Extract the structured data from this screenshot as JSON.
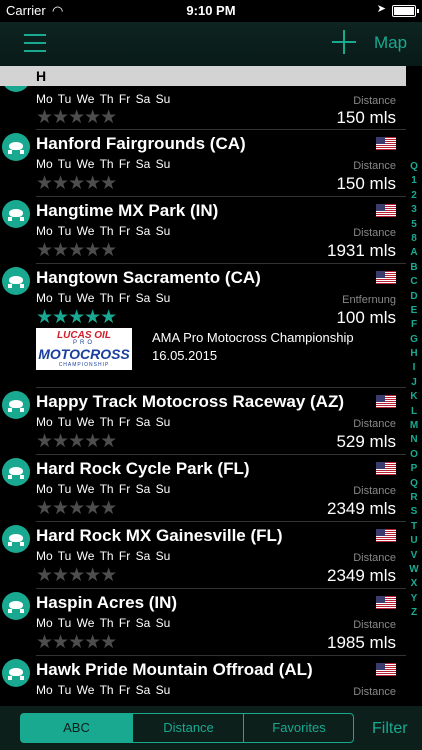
{
  "status": {
    "carrier": "Carrier",
    "time": "9:10 PM"
  },
  "nav": {
    "map_label": "Map"
  },
  "section": {
    "letter": "H"
  },
  "labels": {
    "days": "Mo Tu We Th Fr Sa Su",
    "stars": "★★★★★"
  },
  "rows": [
    {
      "title": "",
      "distance_label": "Distance",
      "distance": "150 mls",
      "rating": 0
    },
    {
      "title": "Hanford Fairgrounds (CA)",
      "distance_label": "Distance",
      "distance": "150 mls",
      "rating": 0
    },
    {
      "title": "Hangtime MX Park (IN)",
      "distance_label": "Distance",
      "distance": "1931 mls",
      "rating": 0
    },
    {
      "title": "Hangtown Sacramento (CA)",
      "distance_label": "Entfernung",
      "distance": "100 mls",
      "rating": 5,
      "event": {
        "title": "AMA Pro Motocross Championship",
        "date": "16.05.2015",
        "logo_lines": [
          "LUCAS OIL",
          "PRO",
          "MOTOCROSS",
          "CHAMPIONSHIP"
        ]
      }
    },
    {
      "title": "Happy Track Motocross Raceway (AZ)",
      "distance_label": "Distance",
      "distance": "529 mls",
      "rating": 0
    },
    {
      "title": "Hard Rock Cycle Park (FL)",
      "distance_label": "Distance",
      "distance": "2349 mls",
      "rating": 0
    },
    {
      "title": "Hard Rock MX Gainesville (FL)",
      "distance_label": "Distance",
      "distance": "2349 mls",
      "rating": 0
    },
    {
      "title": "Haspin Acres (IN)",
      "distance_label": "Distance",
      "distance": "1985 mls",
      "rating": 0
    },
    {
      "title": "Hawk Pride Mountain Offroad (AL)",
      "distance_label": "Distance",
      "distance": "",
      "rating": 0
    }
  ],
  "index": [
    "Q",
    "1",
    "2",
    "3",
    "5",
    "8",
    "A",
    "B",
    "C",
    "D",
    "E",
    "F",
    "G",
    "H",
    "I",
    "J",
    "K",
    "L",
    "M",
    "N",
    "O",
    "P",
    "Q",
    "R",
    "S",
    "T",
    "U",
    "V",
    "W",
    "X",
    "Y",
    "Z"
  ],
  "tabs": {
    "abc": "ABC",
    "distance": "Distance",
    "favorites": "Favorites",
    "selected": "abc"
  },
  "filter_label": "Filter",
  "colors": {
    "accent": "#19a991",
    "background": "#000000",
    "section_header": "#d3d3d3"
  }
}
